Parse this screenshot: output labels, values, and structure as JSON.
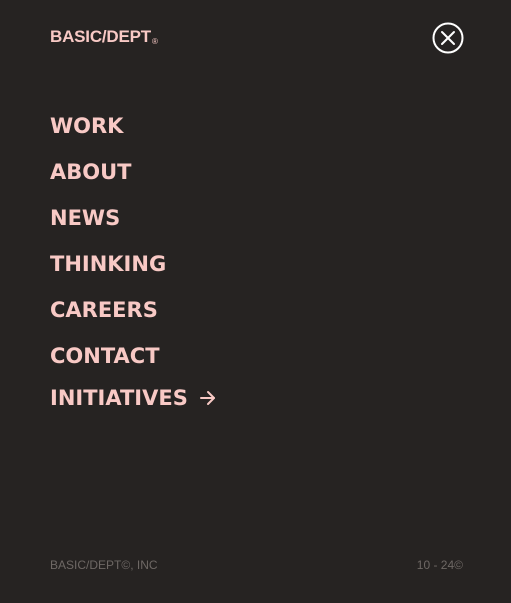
{
  "header": {
    "logo_text": "BASIC/DEPT",
    "logo_mark": "®",
    "close_icon": "close-circle-icon"
  },
  "nav": {
    "items": [
      {
        "label": "WORK"
      },
      {
        "label": "ABOUT"
      },
      {
        "label": "NEWS"
      },
      {
        "label": "THINKING"
      },
      {
        "label": "CAREERS"
      },
      {
        "label": "CONTACT"
      },
      {
        "label": "INITIATIVES",
        "icon": "arrow-right-icon"
      }
    ]
  },
  "footer": {
    "company": "BASIC/DEPT©, INC",
    "years": "10 - 24©"
  },
  "colors": {
    "background": "#262322",
    "accent": "#f8c9c5",
    "muted": "#6e6865",
    "close_icon": "#ffffff"
  }
}
